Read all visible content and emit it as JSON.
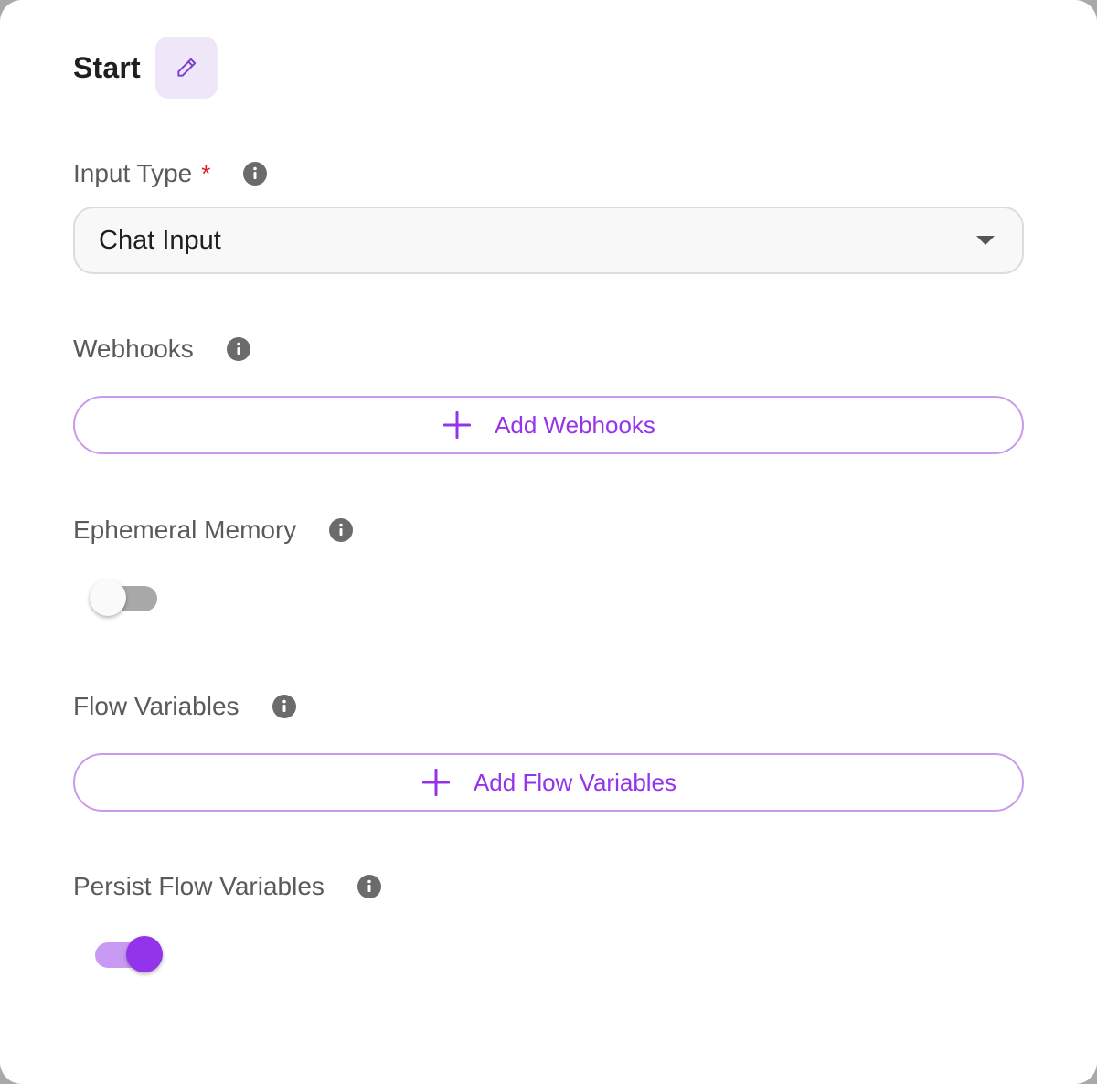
{
  "header": {
    "title": "Start",
    "edit_icon": "pencil-icon"
  },
  "input_type": {
    "label": "Input Type",
    "required_mark": "*",
    "info_icon": "info-icon",
    "selected": "Chat Input"
  },
  "webhooks": {
    "label": "Webhooks",
    "info_icon": "info-icon",
    "button_label": "Add Webhooks"
  },
  "ephemeral_memory": {
    "label": "Ephemeral Memory",
    "info_icon": "info-icon",
    "enabled": false
  },
  "flow_variables": {
    "label": "Flow Variables",
    "info_icon": "info-icon",
    "button_label": "Add Flow Variables"
  },
  "persist_flow_variables": {
    "label": "Persist Flow Variables",
    "info_icon": "info-icon",
    "enabled": true
  },
  "colors": {
    "accent": "#9333ea",
    "accent_soft": "#efe7f8",
    "required": "#e01e1e",
    "label": "#5a5a5a"
  }
}
